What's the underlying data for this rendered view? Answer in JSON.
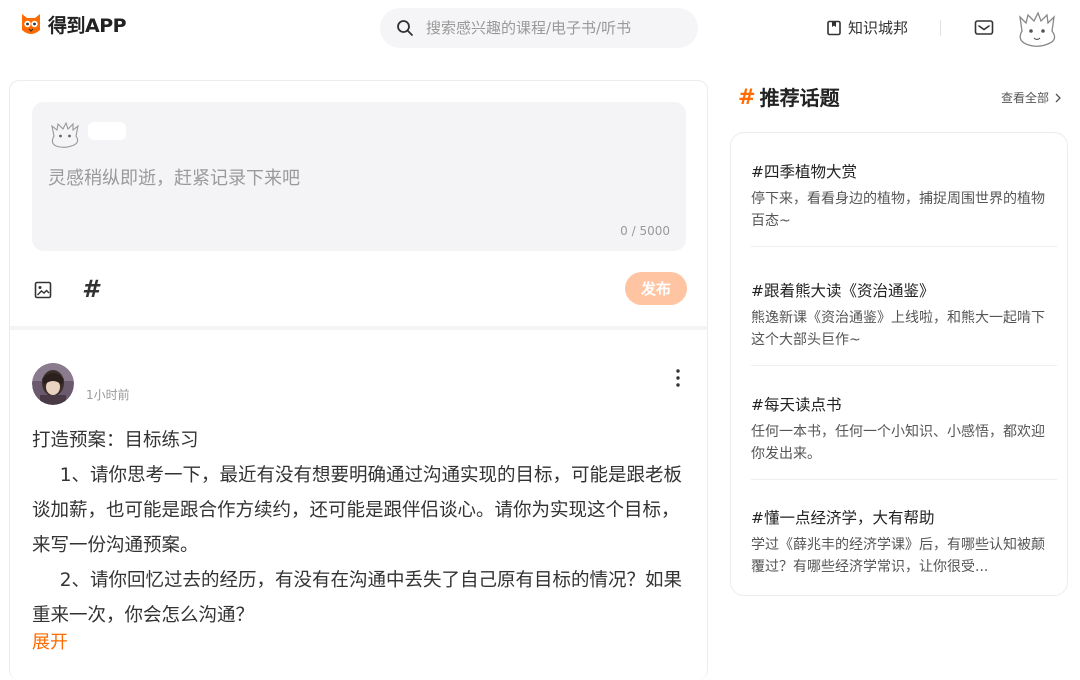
{
  "header": {
    "logo_text": "得到APP",
    "search_placeholder": "搜索感兴趣的课程/电子书/听书",
    "store_label": "知识城邦"
  },
  "composer": {
    "placeholder": "灵感稍纵即逝，赶紧记录下来吧",
    "counter": "0 / 5000",
    "publish_label": "发布"
  },
  "post": {
    "time": "1小时前",
    "paragraphs": [
      "打造预案：目标练习",
      "1、请你思考一下，最近有没有想要明确通过沟通实现的目标，可能是跟老板谈加薪，也可能是跟合作方续约，还可能是跟伴侣谈心。请你为实现这个目标，来写一份沟通预案。",
      "2、请你回忆过去的经历，有没有在沟通中丢失了自己原有目标的情况？如果重来一次，你会怎么沟通？"
    ],
    "expand_label": "展开"
  },
  "topics": {
    "hash": "#",
    "title": "推荐话题",
    "view_all": "查看全部",
    "items": [
      {
        "title": "#四季植物大赏",
        "desc": "停下来，看看身边的植物，捕捉周围世界的植物百态~"
      },
      {
        "title": "#跟着熊大读《资治通鉴》",
        "desc": "熊逸新课《资治通鉴》上线啦，和熊大一起啃下这个大部头巨作~"
      },
      {
        "title": "#每天读点书",
        "desc": "任何一本书，任何一个小知识、小感悟，都欢迎你发出来。"
      },
      {
        "title": "#懂一点经济学，大有帮助",
        "desc": "学过《薛兆丰的经济学课》后，有哪些认知被颠覆过？有哪些经济学常识，让你很受..."
      }
    ]
  },
  "colors": {
    "accent": "#ff6b00",
    "publish_disabled": "#ffc4a2"
  }
}
